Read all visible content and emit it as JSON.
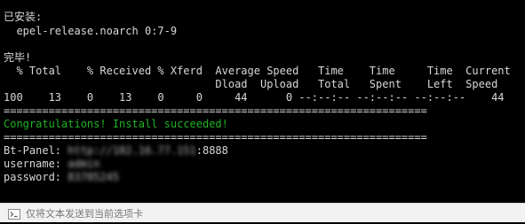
{
  "terminal": {
    "installed_header": "已安装:",
    "installed_package": "  epel-release.noarch 0:7-9",
    "done": "完毕!",
    "curl_header_1": "  % Total    % Received % Xferd  Average Speed   Time    Time     Time  Current",
    "curl_header_2": "                                 Dload  Upload   Total   Spent    Left  Speed",
    "curl_progress": "100    13    0    13    0     0     44      0 --:--:-- --:--:-- --:--:--    44",
    "separator_1": "==================================================================",
    "congrats": "Congratulations! Install succeeded!",
    "separator_2": "==================================================================",
    "panel_label": "Bt-Panel: ",
    "panel_url_blurred": "http://182.16.77.151",
    "panel_port": ":8888",
    "username_label": "username: ",
    "username_blurred": "admin",
    "password_label": "password: ",
    "password_blurred": "83705245"
  },
  "status_bar": {
    "icon": "terminal-prompt-icon",
    "text": "仅将文本发送到当前选项卡"
  },
  "colors": {
    "background": "#000000",
    "text": "#d8d8d8",
    "success": "#1fb322",
    "status_bar_bg": "#f2f2f2"
  }
}
